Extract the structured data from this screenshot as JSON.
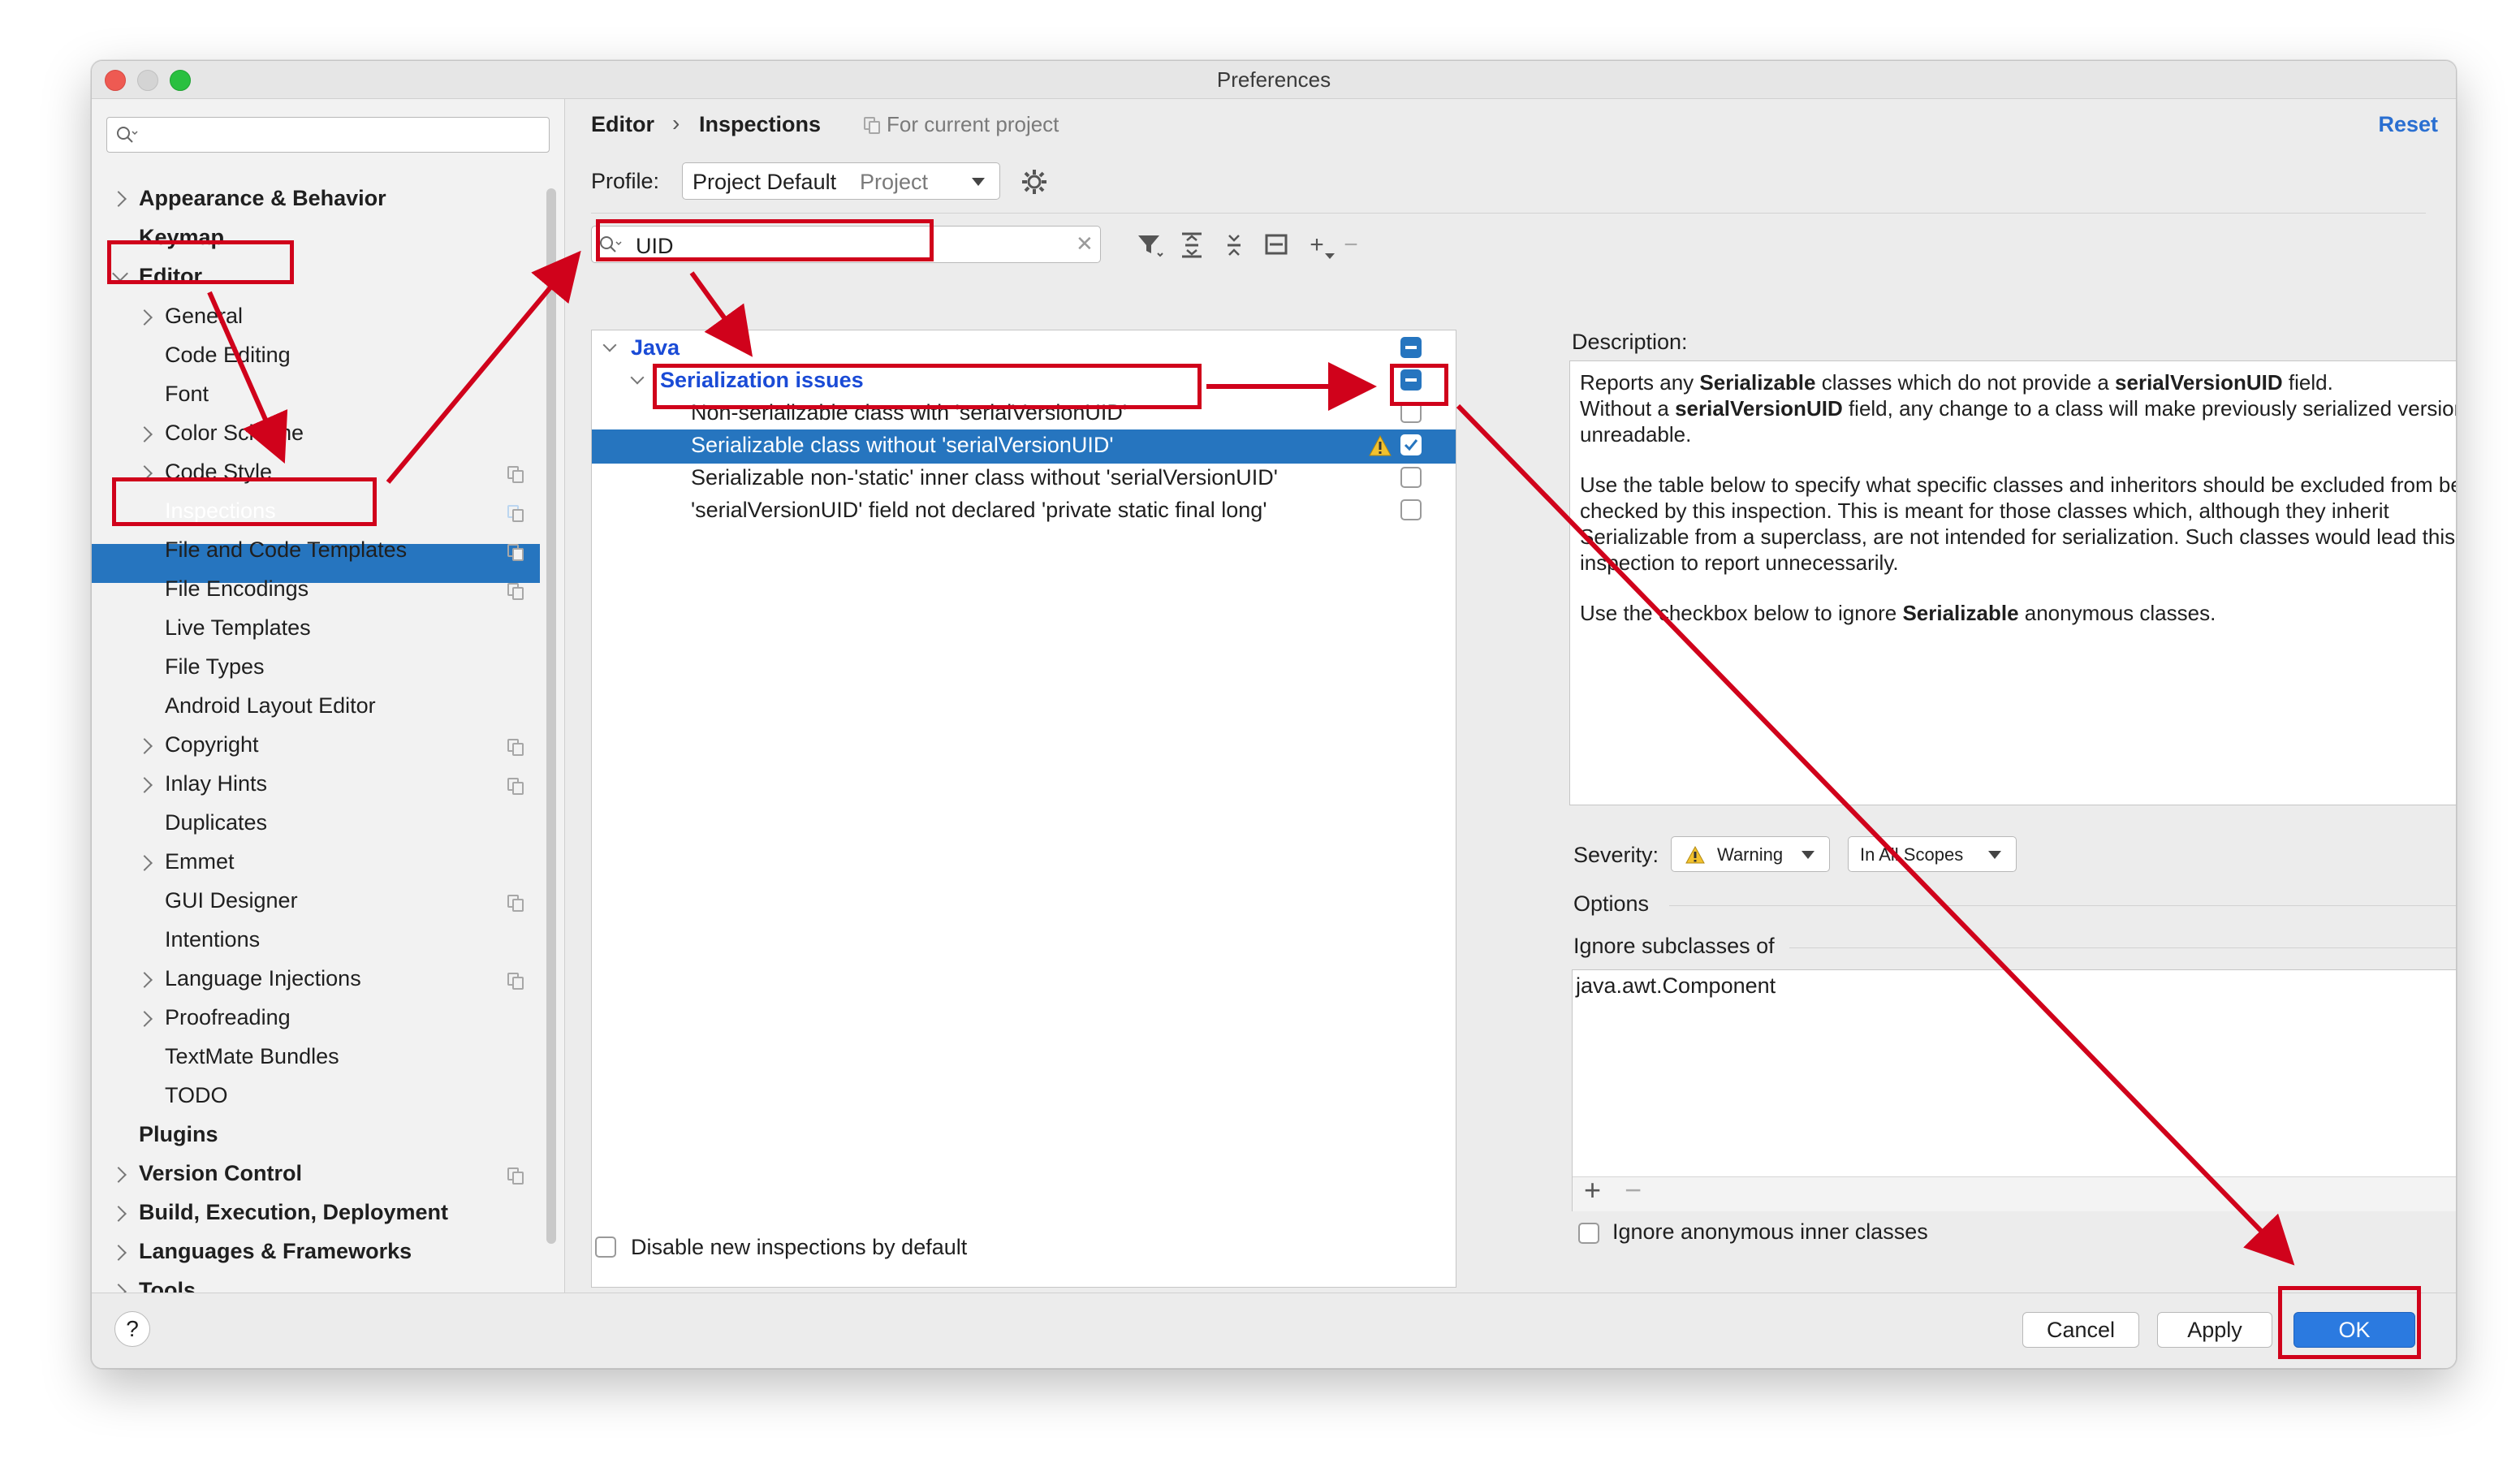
{
  "window": {
    "title": "Preferences"
  },
  "sidebar": {
    "search_placeholder": "",
    "items": [
      {
        "label": "Appearance & Behavior"
      },
      {
        "label": "Keymap"
      },
      {
        "label": "Editor"
      },
      {
        "label": "General"
      },
      {
        "label": "Code Editing"
      },
      {
        "label": "Font"
      },
      {
        "label": "Color Scheme"
      },
      {
        "label": "Code Style"
      },
      {
        "label": "Inspections"
      },
      {
        "label": "File and Code Templates"
      },
      {
        "label": "File Encodings"
      },
      {
        "label": "Live Templates"
      },
      {
        "label": "File Types"
      },
      {
        "label": "Android Layout Editor"
      },
      {
        "label": "Copyright"
      },
      {
        "label": "Inlay Hints"
      },
      {
        "label": "Duplicates"
      },
      {
        "label": "Emmet"
      },
      {
        "label": "GUI Designer"
      },
      {
        "label": "Intentions"
      },
      {
        "label": "Language Injections"
      },
      {
        "label": "Proofreading"
      },
      {
        "label": "TextMate Bundles"
      },
      {
        "label": "TODO"
      },
      {
        "label": "Plugins"
      },
      {
        "label": "Version Control"
      },
      {
        "label": "Build, Execution, Deployment"
      },
      {
        "label": "Languages & Frameworks"
      },
      {
        "label": "Tools"
      }
    ]
  },
  "header": {
    "breadcrumb_1": "Editor",
    "breadcrumb_sep": "›",
    "breadcrumb_2": "Inspections",
    "scope_note": "For current project",
    "reset": "Reset"
  },
  "profile": {
    "label": "Profile:",
    "value": "Project Default",
    "scope": "Project"
  },
  "filter": {
    "value": "UID"
  },
  "tree": {
    "java": "Java",
    "group": "Serialization issues",
    "items": [
      {
        "label": "Non-serializable class with 'serialVersionUID'",
        "checked": false
      },
      {
        "label": "Serializable class without 'serialVersionUID'",
        "checked": true
      },
      {
        "label": "Serializable non-'static' inner class without 'serialVersionUID'",
        "checked": false
      },
      {
        "label": "'serialVersionUID' field not declared 'private static final long'",
        "checked": false
      }
    ]
  },
  "disable_new": "Disable new inspections by default",
  "description": {
    "label": "Description:",
    "p1_a": "Reports any ",
    "p1_b": "Serializable",
    "p1_c": " classes which do not provide a ",
    "p1_d": "serialVersionUID",
    "p1_e": " field.",
    "p1_f": "Without a ",
    "p1_g": "serialVersionUID",
    "p1_h": " field, any change to a class will make previously serialized versions unreadable.",
    "p2": "Use the table below to specify what specific classes and inheritors should be excluded from being checked by this inspection. This is meant for those classes which, although they inherit Serializable from a superclass, are not intended for serialization. Such classes would lead this inspection to report unnecessarily.",
    "p3_a": "Use the checkbox below to ignore ",
    "p3_b": "Serializable",
    "p3_c": " anonymous classes."
  },
  "severity": {
    "label": "Severity:",
    "value": "Warning",
    "scope": "In All Scopes"
  },
  "options": {
    "label": "Options",
    "ignore_subclasses_label": "Ignore subclasses of",
    "ignore_subclasses_items": [
      "java.awt.Component"
    ],
    "add": "+",
    "remove": "−",
    "ignore_anonymous": "Ignore anonymous inner classes"
  },
  "footer": {
    "help": "?",
    "cancel": "Cancel",
    "apply": "Apply",
    "ok": "OK"
  },
  "colors": {
    "selection": "#2675bf",
    "annotation_red": "#d0021b",
    "link_blue": "#1a4bd6",
    "warning_yellow": "#f2c12e"
  },
  "icons": [
    "search-icon",
    "chevron-right-icon",
    "chevron-down-icon",
    "copy-icon",
    "gear-icon",
    "filter-icon",
    "expand-all-icon",
    "collapse-all-icon",
    "reset-icon",
    "plus-icon",
    "minus-icon",
    "warning-icon",
    "clear-icon",
    "help-icon"
  ]
}
